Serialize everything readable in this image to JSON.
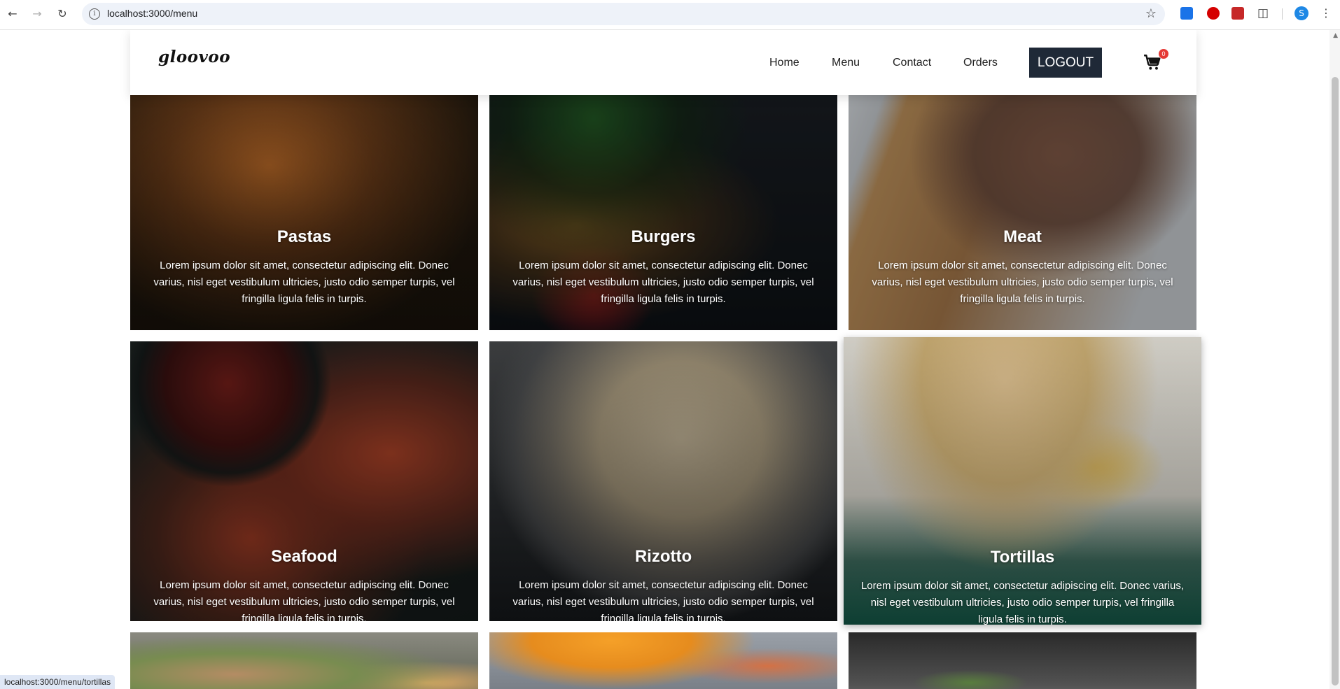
{
  "browser": {
    "url": "localhost:3000/menu",
    "profile_initial": "S"
  },
  "site": {
    "logo": "gloovoo",
    "nav": [
      "Home",
      "Menu",
      "Contact",
      "Orders"
    ],
    "logout_label": "LOGOUT",
    "cart_count": "0"
  },
  "cards": [
    {
      "title": "Pastas",
      "description": "Lorem ipsum dolor sit amet, consectetur adipiscing elit. Donec varius, nisl eget vestibulum ultricies, justo odio semper turpis, vel fringilla ligula felis in turpis."
    },
    {
      "title": "Burgers",
      "description": "Lorem ipsum dolor sit amet, consectetur adipiscing elit. Donec varius, nisl eget vestibulum ultricies, justo odio semper turpis, vel fringilla ligula felis in turpis."
    },
    {
      "title": "Meat",
      "description": "Lorem ipsum dolor sit amet, consectetur adipiscing elit. Donec varius, nisl eget vestibulum ultricies, justo odio semper turpis, vel fringilla ligula felis in turpis."
    },
    {
      "title": "Seafood",
      "description": "Lorem ipsum dolor sit amet, consectetur adipiscing elit. Donec varius, nisl eget vestibulum ultricies, justo odio semper turpis, vel fringilla ligula felis in turpis."
    },
    {
      "title": "Rizotto",
      "description": "Lorem ipsum dolor sit amet, consectetur adipiscing elit. Donec varius, nisl eget vestibulum ultricies, justo odio semper turpis, vel fringilla ligula felis in turpis."
    },
    {
      "title": "Tortillas",
      "description": "Lorem ipsum dolor sit amet, consectetur adipiscing elit. Donec varius, nisl eget vestibulum ultricies, justo odio semper turpis, vel fringilla ligula felis in turpis."
    }
  ],
  "status_bar_url": "localhost:3000/menu/tortillas"
}
